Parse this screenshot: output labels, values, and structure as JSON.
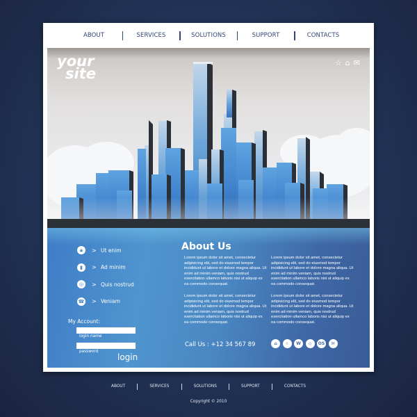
{
  "nav": {
    "items": [
      "ABOUT",
      "SERVICES",
      "SOLUTIONS",
      "SUPPORT",
      "CONTACTS"
    ]
  },
  "hero": {
    "logo_line1": "your",
    "logo_line2": "site",
    "icons": [
      "star-icon",
      "home-icon",
      "mail-icon"
    ]
  },
  "sidebar": {
    "items": [
      {
        "label": "Ut enim",
        "icon": "lock-icon"
      },
      {
        "label": "Ad minim",
        "icon": "book-icon"
      },
      {
        "label": "Quis nostrud",
        "icon": "target-icon"
      },
      {
        "label": "Veniam",
        "icon": "phone-icon"
      }
    ],
    "chevron": ">"
  },
  "account": {
    "title": "My Account:",
    "login_name_caption": "login name",
    "password_caption": "password",
    "login_label": "login"
  },
  "about": {
    "title": "About Us",
    "paragraphs": [
      "Lorem ipsum dolor sit amet, consectetur adipisicing elit, sed do eiusmod tempor incididunt ut labore et dolore magna aliqua. Ut enim ad minim veniam, quis nostrud exercitation ullamco laboris nisi ut aliquip ex ea commodo consequat.",
      "Lorem ipsum dolor sit amet, consectetur adipisicing elit, sed do eiusmod tempor incididunt ut labore et dolore magna aliqua. Ut enim ad minim veniam, quis nostrud exercitation ullamco laboris nisi ut aliquip ex ea commodo consequat.",
      "Lorem ipsum dolor sit amet, consectetur adipisicing elit, sed do eiusmod tempor incididunt ut labore et dolore magna aliqua. Ut enim ad minim veniam, quis nostrud exercitation ullamco laboris nisi ut aliquip ex ea commodo consequat.",
      "Lorem ipsum dolor sit amet, consectetur adipisicing elit, sed do eiusmod tempor incididunt ut labore et dolore magna aliqua. Ut enim ad minim veniam, quis nostrud exercitation ullamco laboris nisi ut aliquip ex ea commodo consequat."
    ]
  },
  "contact": {
    "call_us": "Call Us : +12 34 567 89",
    "socials": [
      {
        "name": "home-social-icon",
        "glyph": "⌂"
      },
      {
        "name": "star-social-icon",
        "glyph": "☆"
      },
      {
        "name": "w-social-icon",
        "glyph": "W"
      },
      {
        "name": "compass-social-icon",
        "glyph": "◇"
      },
      {
        "name": "os-social-icon",
        "glyph": "OS"
      },
      {
        "name": "mail-social-icon",
        "glyph": "✉"
      }
    ]
  },
  "footer": {
    "items": [
      "ABOUT",
      "SERVICES",
      "SOLUTIONS",
      "SUPPORT",
      "CONTACTS"
    ],
    "copyright": "Copyright © 2010"
  }
}
